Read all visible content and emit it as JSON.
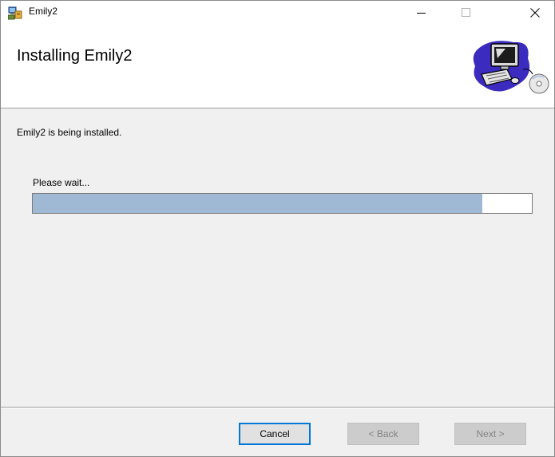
{
  "window": {
    "title": "Emily2",
    "icons": {
      "app": "installer-icon",
      "minimize": "minimize-icon",
      "maximize": "maximize-icon",
      "close": "close-icon"
    }
  },
  "banner": {
    "title": "Installing Emily2",
    "art": "computer-cd-icon"
  },
  "main": {
    "status_text": "Emily2 is being installed.",
    "wait_label": "Please wait...",
    "progress_percent": 90
  },
  "buttons": {
    "cancel": "Cancel",
    "back": "< Back",
    "next": "Next >"
  },
  "colors": {
    "progress_fill": "#9fb9d5",
    "focus_border": "#0078d7"
  }
}
